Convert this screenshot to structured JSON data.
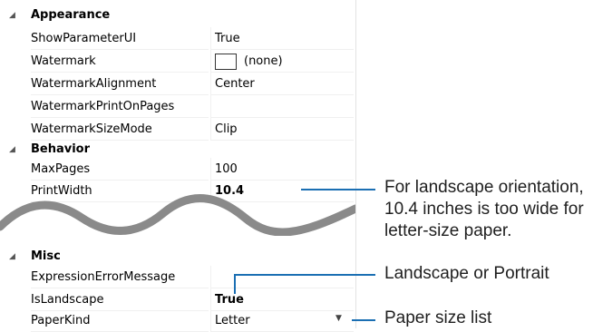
{
  "appearance": {
    "label": "Appearance",
    "show_parameter_ui": {
      "name": "ShowParameterUI",
      "value": "True"
    },
    "watermark": {
      "name": "Watermark",
      "value": "(none)"
    },
    "watermark_alignment": {
      "name": "WatermarkAlignment",
      "value": "Center"
    },
    "watermark_print_on_pages": {
      "name": "WatermarkPrintOnPages",
      "value": ""
    },
    "watermark_size_mode": {
      "name": "WatermarkSizeMode",
      "value": "Clip"
    }
  },
  "behavior": {
    "label": "Behavior",
    "max_pages": {
      "name": "MaxPages",
      "value": "100"
    },
    "print_width": {
      "name": "PrintWidth",
      "value": "10.4"
    }
  },
  "misc": {
    "label": "Misc",
    "expression_error_message": {
      "name": "ExpressionErrorMessage",
      "value": ""
    },
    "is_landscape": {
      "name": "IsLandscape",
      "value": "True"
    },
    "paper_kind": {
      "name": "PaperKind",
      "value": "Letter"
    }
  },
  "annotations": {
    "print_width_note_line1": "For landscape orientation,",
    "print_width_note_line2": "10.4 inches is too wide for",
    "print_width_note_line3": "letter-size paper.",
    "landscape_note": "Landscape or Portrait",
    "paper_note": "Paper size list"
  },
  "colors": {
    "leader": "#1b6fb3",
    "wave": "#8a8a8a"
  },
  "icons": {
    "expanded": "collapse-triangle-icon",
    "dropdown": "dropdown-arrow-icon"
  }
}
